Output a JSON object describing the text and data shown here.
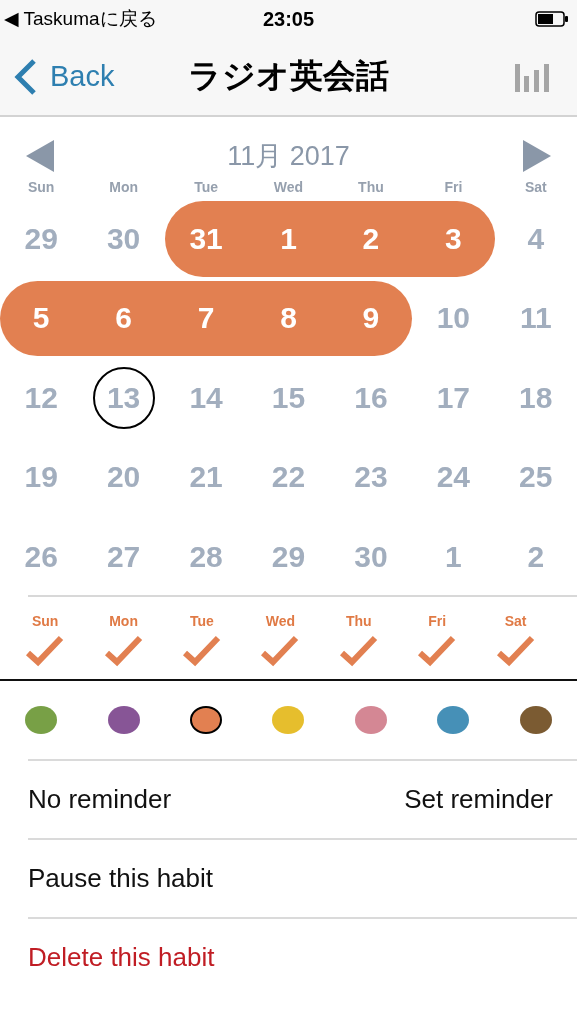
{
  "status_bar": {
    "back_app": "◀ Taskumaに戻る",
    "time": "23:05"
  },
  "nav": {
    "back": "Back",
    "title": "ラジオ英会話"
  },
  "calendar": {
    "month": "11月 2017",
    "weekdays": [
      "Sun",
      "Mon",
      "Tue",
      "Wed",
      "Thu",
      "Fri",
      "Sat"
    ],
    "weeks": [
      [
        {
          "day": "29",
          "done": false,
          "today": false
        },
        {
          "day": "30",
          "done": false,
          "today": false
        },
        {
          "day": "31",
          "done": true,
          "today": false
        },
        {
          "day": "1",
          "done": true,
          "today": false
        },
        {
          "day": "2",
          "done": true,
          "today": false
        },
        {
          "day": "3",
          "done": true,
          "today": false
        },
        {
          "day": "4",
          "done": false,
          "today": false
        }
      ],
      [
        {
          "day": "5",
          "done": true,
          "today": false
        },
        {
          "day": "6",
          "done": true,
          "today": false
        },
        {
          "day": "7",
          "done": true,
          "today": false
        },
        {
          "day": "8",
          "done": true,
          "today": false
        },
        {
          "day": "9",
          "done": true,
          "today": false
        },
        {
          "day": "10",
          "done": false,
          "today": false
        },
        {
          "day": "11",
          "done": false,
          "today": false
        }
      ],
      [
        {
          "day": "12",
          "done": false,
          "today": false
        },
        {
          "day": "13",
          "done": false,
          "today": true
        },
        {
          "day": "14",
          "done": false,
          "today": false
        },
        {
          "day": "15",
          "done": false,
          "today": false
        },
        {
          "day": "16",
          "done": false,
          "today": false
        },
        {
          "day": "17",
          "done": false,
          "today": false
        },
        {
          "day": "18",
          "done": false,
          "today": false
        }
      ],
      [
        {
          "day": "19",
          "done": false,
          "today": false
        },
        {
          "day": "20",
          "done": false,
          "today": false
        },
        {
          "day": "21",
          "done": false,
          "today": false
        },
        {
          "day": "22",
          "done": false,
          "today": false
        },
        {
          "day": "23",
          "done": false,
          "today": false
        },
        {
          "day": "24",
          "done": false,
          "today": false
        },
        {
          "day": "25",
          "done": false,
          "today": false
        }
      ],
      [
        {
          "day": "26",
          "done": false,
          "today": false
        },
        {
          "day": "27",
          "done": false,
          "today": false
        },
        {
          "day": "28",
          "done": false,
          "today": false
        },
        {
          "day": "29",
          "done": false,
          "today": false
        },
        {
          "day": "30",
          "done": false,
          "today": false
        },
        {
          "day": "1",
          "done": false,
          "today": false
        },
        {
          "day": "2",
          "done": false,
          "today": false
        }
      ]
    ]
  },
  "schedule": [
    {
      "label": "Sun",
      "checked": true
    },
    {
      "label": "Mon",
      "checked": true
    },
    {
      "label": "Tue",
      "checked": true
    },
    {
      "label": "Wed",
      "checked": true
    },
    {
      "label": "Thu",
      "checked": true
    },
    {
      "label": "Fri",
      "checked": true
    },
    {
      "label": "Sat",
      "checked": true
    }
  ],
  "colors": [
    {
      "color": "#78a046",
      "selected": false
    },
    {
      "color": "#875596",
      "selected": false
    },
    {
      "color": "#e28051",
      "selected": true
    },
    {
      "color": "#e6be2d",
      "selected": false
    },
    {
      "color": "#d48794",
      "selected": false
    },
    {
      "color": "#4690b7",
      "selected": false
    },
    {
      "color": "#7b5b32",
      "selected": false
    }
  ],
  "rows": [
    {
      "kind": "reminder",
      "label": "No reminder",
      "action": "Set reminder"
    },
    {
      "kind": "plain",
      "label": "Pause this habit"
    },
    {
      "kind": "danger",
      "label": "Delete this habit"
    }
  ]
}
